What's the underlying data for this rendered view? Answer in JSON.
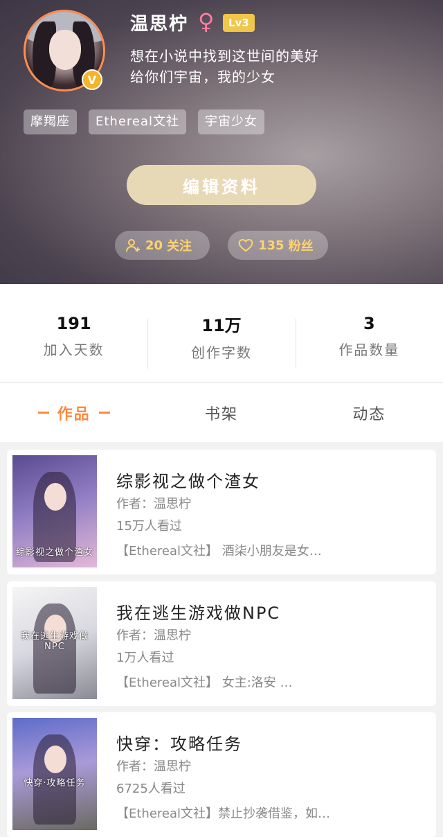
{
  "profile": {
    "name": "温思柠",
    "gender_icon": "female-icon",
    "level": "Lv3",
    "bio_line1": "想在小说中找到这世间的美好",
    "bio_line2": "给你们宇宙，我的少女",
    "verified": "V",
    "tags": [
      "摩羯座",
      "Ethereal文社",
      "宇宙少女"
    ],
    "edit_button": "编辑资料",
    "follow": {
      "icon": "user-plus-icon",
      "count": "20",
      "label": "关注"
    },
    "fans": {
      "icon": "heart-icon",
      "count": "135",
      "label": "粉丝"
    }
  },
  "stats": [
    {
      "value": "191",
      "label": "加入天数"
    },
    {
      "value": "11万",
      "label": "创作字数"
    },
    {
      "value": "3",
      "label": "作品数量"
    }
  ],
  "tabs": [
    {
      "label": "作品",
      "active": true
    },
    {
      "label": "书架",
      "active": false
    },
    {
      "label": "动态",
      "active": false
    }
  ],
  "books": [
    {
      "title": "综影视之做个渣女",
      "author": "作者：温思柠",
      "views": "15万人看过",
      "desc": "【Ethereal文社】 酒柒小朋友是女…",
      "cover_text": "综影视之做个渣女"
    },
    {
      "title": "我在逃生游戏做NPC",
      "author": "作者：温思柠",
      "views": "1万人看过",
      "desc": "【Ethereal文社】 女主:洛安 …",
      "cover_text": "我在逃生游戏做NPC"
    },
    {
      "title": "快穿：攻略任务",
      "author": "作者：温思柠",
      "views": "6725人看过",
      "desc": "【Ethereal文社】禁止抄袭借鉴，如…",
      "cover_text": "快穿·攻略任务"
    }
  ],
  "colors": {
    "accent": "#ff8a3d",
    "avatar_ring": "#ff8d4f",
    "level_badge": "#f0c64b",
    "edit_button_bg": "#e8d9b6",
    "pill_text": "#ffd36e"
  }
}
